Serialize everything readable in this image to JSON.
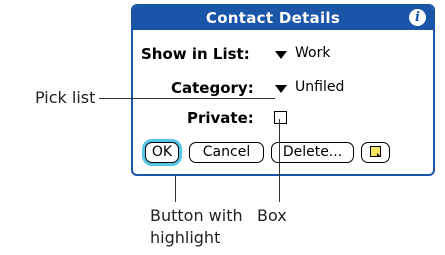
{
  "dialog": {
    "title": "Contact Details",
    "info_icon_glyph": "i",
    "show_in_list": {
      "label": "Show in List:",
      "value": "Work"
    },
    "category": {
      "label": "Category:",
      "value": "Unfiled"
    },
    "private": {
      "label": "Private:",
      "checked": false
    },
    "buttons": {
      "ok": "OK",
      "cancel": "Cancel",
      "delete": "Delete..."
    },
    "highlight_color": "#55c5e8",
    "titlebar_color": "#1a55a8",
    "note_icon": "note-icon"
  },
  "callouts": {
    "pick_list": "Pick list",
    "button_highlight_line1": "Button with",
    "button_highlight_line2": "highlight",
    "box": "Box"
  }
}
